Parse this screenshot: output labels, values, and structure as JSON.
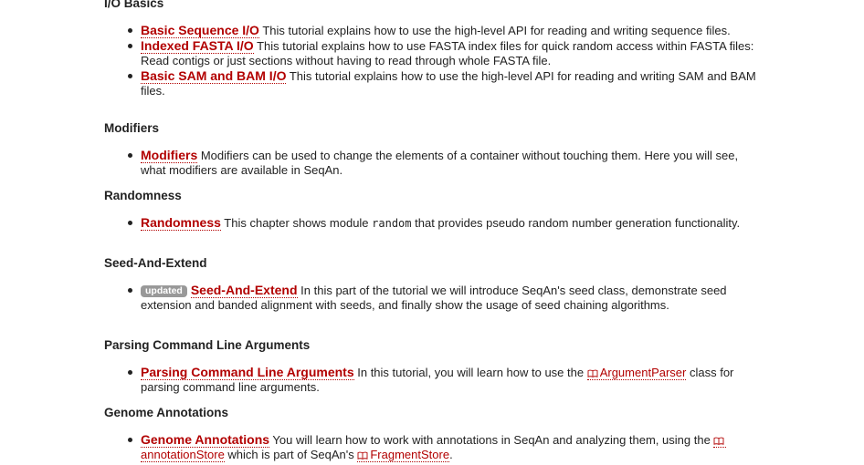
{
  "sections": [
    {
      "heading": "I/O Basics",
      "items": [
        {
          "link": "Basic Sequence I/O",
          "text": " This tutorial explains how to use the high-level API for reading and writing sequence files."
        },
        {
          "link": "Indexed FASTA I/O",
          "text": " This tutorial explains how to use FASTA index files for quick random access within FASTA files: Read contigs or just sections without having to read through whole FASTA file."
        },
        {
          "link": "Basic SAM and BAM I/O",
          "text": " This tutorial explains how to use the high-level API for reading and writing SAM and BAM files."
        }
      ]
    },
    {
      "heading": "Modifiers",
      "items": [
        {
          "link": "Modifiers",
          "text": " Modifiers can be used to change the elements of a container without touching them. Here you will see, what modifiers are available in SeqAn."
        }
      ]
    },
    {
      "heading": "Randomness",
      "items": [
        {
          "link": "Randomness",
          "text_before": " This chapter shows module ",
          "code": "random",
          "text_after": " that provides pseudo random number generation functionality."
        }
      ]
    },
    {
      "heading": "Seed-And-Extend",
      "items": [
        {
          "badge": "updated",
          "link": "Seed-And-Extend",
          "text": " In this part of the tutorial we will introduce SeqAn's seed class, demonstrate seed extension and banded alignment with seeds, and finally show the usage of seed chaining algorithms."
        }
      ]
    },
    {
      "heading": "Parsing Command Line Arguments",
      "items": [
        {
          "link": "Parsing Command Line Arguments",
          "text_before": " In this tutorial, you will learn how to use the ",
          "api": "ArgumentParser",
          "text_after": " class for parsing command line arguments."
        }
      ]
    },
    {
      "heading": "Genome Annotations",
      "items": [
        {
          "link": "Genome Annotations",
          "text_before": " You will learn how to work with annotations in SeqAn and analyzing them, using the ",
          "api": "annotationStore",
          "text_mid": " which is part of SeqAn's ",
          "api2": "FragmentStore",
          "text_after": "."
        }
      ]
    }
  ]
}
